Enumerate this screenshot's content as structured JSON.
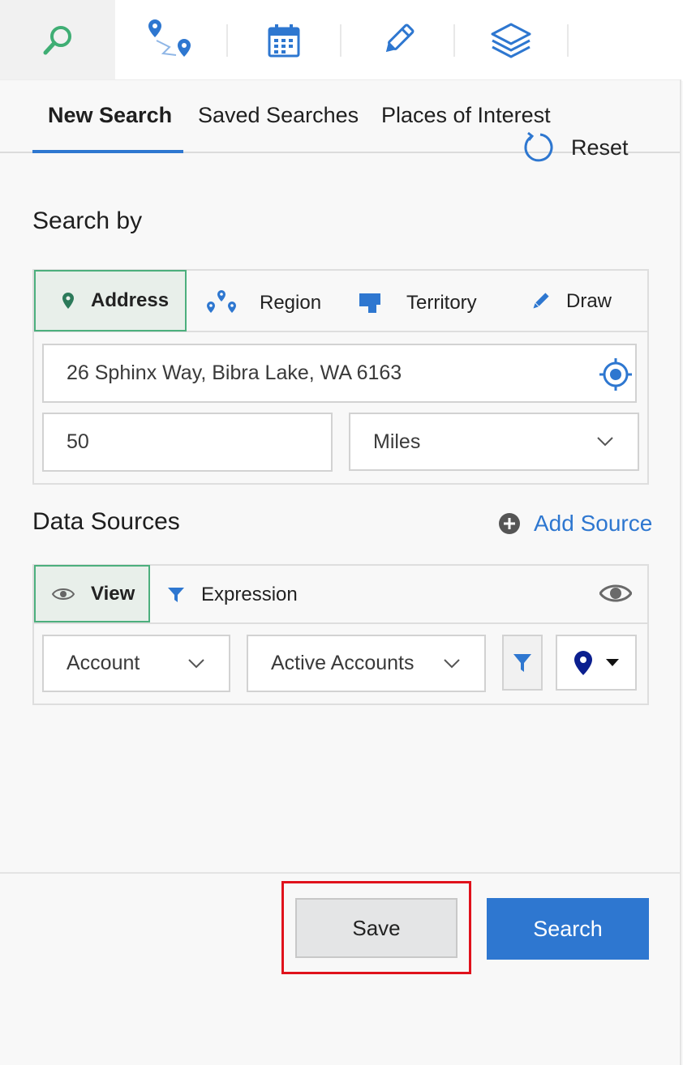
{
  "toolbar": {
    "icons": [
      "search-icon",
      "route-icon",
      "calendar-icon",
      "pencil-icon",
      "layers-icon"
    ]
  },
  "tabs": [
    {
      "label": "New Search",
      "active": true
    },
    {
      "label": "Saved Searches",
      "active": false
    },
    {
      "label": "Places of Interest",
      "active": false
    }
  ],
  "search_by": {
    "title": "Search by",
    "reset_label": "Reset",
    "modes": [
      {
        "label": "Address",
        "icon": "map-pin-icon",
        "active": true
      },
      {
        "label": "Region",
        "icon": "multi-pin-icon",
        "active": false
      },
      {
        "label": "Territory",
        "icon": "territory-icon",
        "active": false
      },
      {
        "label": "Draw",
        "icon": "pencil-icon",
        "active": false
      }
    ],
    "address_value": "26 Sphinx Way, Bibra Lake, WA 6163",
    "radius_value": "50",
    "unit_selected": "Miles"
  },
  "data_sources": {
    "title": "Data Sources",
    "add_source_label": "Add Source",
    "modes": [
      {
        "label": "View",
        "icon": "eye-icon",
        "active": true
      },
      {
        "label": "Expression",
        "icon": "filter-icon",
        "active": false
      }
    ],
    "entity_selected": "Account",
    "view_selected": "Active Accounts",
    "pin_color": "#0b1f8f"
  },
  "footer": {
    "save_label": "Save",
    "search_label": "Search"
  },
  "colors": {
    "accent": "#2e77d0",
    "active_green": "#4caf7d",
    "highlight_red": "#e0121c"
  }
}
